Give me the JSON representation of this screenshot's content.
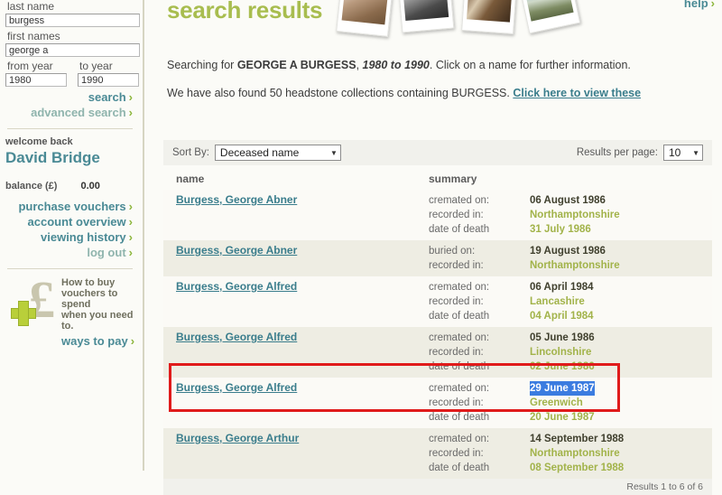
{
  "search_form": {
    "last_name_label": "last name",
    "last_name_value": "burgess",
    "first_names_label": "first names",
    "first_names_value": "george a",
    "from_year_label": "from year",
    "from_year_value": "1980",
    "to_year_label": "to year",
    "to_year_value": "1990",
    "search_label": "search",
    "advanced_search_label": "advanced search",
    "chevron": "›"
  },
  "account": {
    "welcome_label": "welcome back",
    "user_name": "David Bridge",
    "balance_label": "balance (£)",
    "balance_value": "0.00",
    "links": [
      {
        "label": "purchase vouchers",
        "muted": false
      },
      {
        "label": "account overview",
        "muted": false
      },
      {
        "label": "viewing history",
        "muted": false
      },
      {
        "label": "log out",
        "muted": true
      }
    ]
  },
  "promo": {
    "line1": "How to buy",
    "line2": "vouchers to spend",
    "line3": "when you need to.",
    "cta": "ways to pay",
    "pound_symbol": "£"
  },
  "header": {
    "title": "search results",
    "help_label": "help"
  },
  "intro": {
    "searching_prefix": "Searching for ",
    "searching_name": "GEORGE A BURGESS",
    "searching_comma": ", ",
    "searching_years": "1980 to 1990",
    "searching_suffix": ". Click on a name for further information.",
    "headstone_prefix": "We have also found 50 headstone collections containing BURGESS. ",
    "headstone_link": "Click here to view these"
  },
  "toolbar": {
    "sort_by_label": "Sort By:",
    "sort_by_value": "Deceased name",
    "results_per_page_label": "Results per page:",
    "results_per_page_value": "10",
    "arrow": "▼"
  },
  "table": {
    "col_name": "name",
    "col_summary": "summary",
    "rows": [
      {
        "name": "Burgess, George Abner",
        "details": [
          {
            "key": "cremated on:",
            "value": "06 August 1986",
            "style": "dark"
          },
          {
            "key": "recorded in:",
            "value": "Northamptonshire",
            "style": "olive"
          },
          {
            "key": "date of death",
            "value": "31 July 1986",
            "style": "olive"
          }
        ]
      },
      {
        "name": "Burgess, George Abner",
        "details": [
          {
            "key": "buried on:",
            "value": "19 August 1986",
            "style": "dark"
          },
          {
            "key": "recorded in:",
            "value": "Northamptonshire",
            "style": "olive"
          }
        ]
      },
      {
        "name": "Burgess, George Alfred",
        "details": [
          {
            "key": "cremated on:",
            "value": "06 April 1984",
            "style": "dark"
          },
          {
            "key": "recorded in:",
            "value": "Lancashire",
            "style": "olive"
          },
          {
            "key": "date of death",
            "value": "04 April 1984",
            "style": "olive"
          }
        ]
      },
      {
        "name": "Burgess, George Alfred",
        "details": [
          {
            "key": "cremated on:",
            "value": "05 June 1986",
            "style": "dark"
          },
          {
            "key": "recorded in:",
            "value": "Lincolnshire",
            "style": "olive"
          },
          {
            "key": "date of death",
            "value": "02 June 1986",
            "style": "olive"
          }
        ]
      },
      {
        "name": "Burgess, George Alfred",
        "details": [
          {
            "key": "cremated on:",
            "value": "29 June 1987",
            "style": "sel"
          },
          {
            "key": "recorded in:",
            "value": "Greenwich",
            "style": "olive"
          },
          {
            "key": "date of death",
            "value": "20 June 1987",
            "style": "olive"
          }
        ]
      },
      {
        "name": "Burgess, George Arthur",
        "details": [
          {
            "key": "cremated on:",
            "value": "14 September 1988",
            "style": "dark"
          },
          {
            "key": "recorded in:",
            "value": "Northamptonshire",
            "style": "olive"
          },
          {
            "key": "date of death",
            "value": "08 September 1988",
            "style": "olive"
          }
        ]
      }
    ],
    "footer": "Results 1 to 6 of 6"
  },
  "annotation": {
    "highlight_color": "#e01b1b"
  }
}
